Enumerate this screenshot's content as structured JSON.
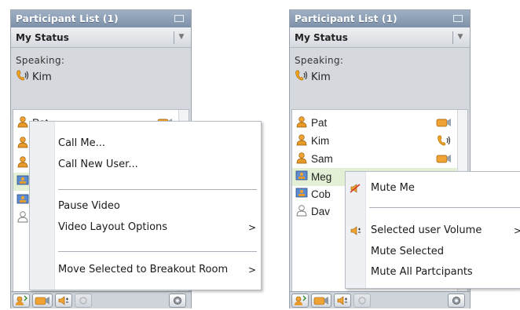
{
  "colors": {
    "title_bar": "#8a9bb0",
    "selected_row": "#e4f0d5",
    "menu_gutter": "#eef0f3"
  },
  "panels": [
    {
      "title": "Participant List (1)",
      "status_label": "My Status",
      "speaking_label": "Speaking:",
      "speaking_name": "Kim",
      "participants": [
        {
          "name": "Pat",
          "icon": "person-icon",
          "status_icon": "camera-icon",
          "selected": false
        }
      ],
      "context_menu": {
        "items": [
          {
            "label": "Call Me..."
          },
          {
            "label": "Call New User..."
          },
          {
            "label": "Pause Video"
          },
          {
            "label": "Video Layout Options",
            "submenu": ">"
          },
          {
            "label": "Move Selected to Breakout Room",
            "submenu": ">"
          }
        ]
      }
    },
    {
      "title": "Participant List (1)",
      "status_label": "My Status",
      "speaking_label": "Speaking:",
      "speaking_name": "Kim",
      "participants": [
        {
          "name": "Pat",
          "icon": "person-icon",
          "status_icon": "camera-icon"
        },
        {
          "name": "Kim",
          "icon": "person-icon",
          "status_icon": "phone-speaking-icon"
        },
        {
          "name": "Sam",
          "icon": "person-icon",
          "status_icon": "camera-icon"
        },
        {
          "name": "Meg",
          "icon": "video-user-icon",
          "selected": true
        },
        {
          "name": "Cob",
          "icon": "video-user-icon"
        },
        {
          "name": "Dav",
          "icon": "guest-user-icon"
        }
      ],
      "context_menu": {
        "items": [
          {
            "label": "Mute Me",
            "icon": "speaker-mute-icon"
          },
          {
            "label": "Selected user Volume",
            "icon": "volume-icon",
            "submenu": ">"
          },
          {
            "label": "Mute Selected"
          },
          {
            "label": "Mute All Partcipants"
          }
        ]
      }
    }
  ]
}
